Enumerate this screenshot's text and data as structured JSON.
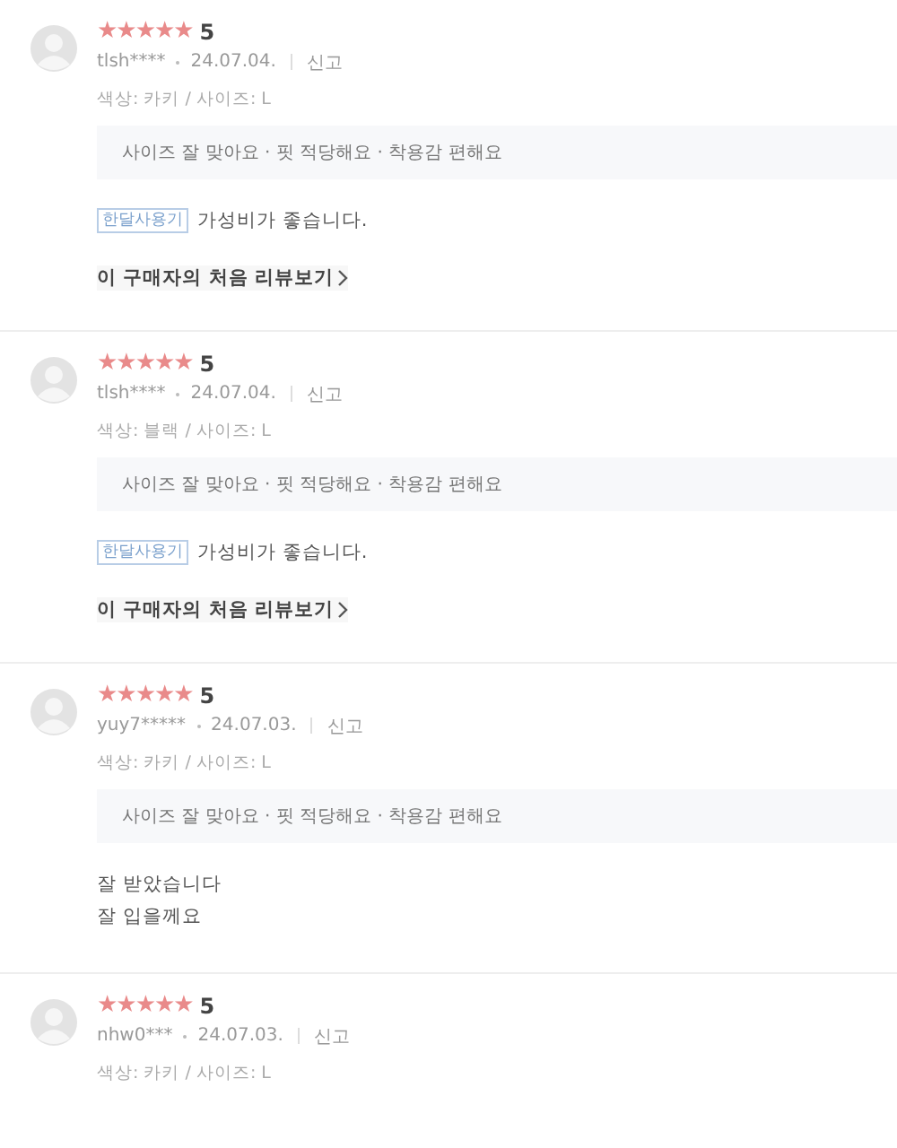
{
  "reviews": [
    {
      "stars": 5,
      "score": "5",
      "user": "tlsh****",
      "date": "24.07.04.",
      "report": "신고",
      "options": "색상: 카키 / 사이즈: L",
      "summary": "사이즈 잘 맞아요 · 핏 적당해요 · 착용감 편해요",
      "tag": "한달사용기",
      "body": [
        "가성비가 좋습니다."
      ],
      "first_review_link": "이 구매자의 처음 리뷰보기"
    },
    {
      "stars": 5,
      "score": "5",
      "user": "tlsh****",
      "date": "24.07.04.",
      "report": "신고",
      "options": "색상: 블랙 / 사이즈: L",
      "summary": "사이즈 잘 맞아요 · 핏 적당해요 · 착용감 편해요",
      "tag": "한달사용기",
      "body": [
        "가성비가 좋습니다."
      ],
      "first_review_link": "이 구매자의 처음 리뷰보기"
    },
    {
      "stars": 5,
      "score": "5",
      "user": "yuy7*****",
      "date": "24.07.03.",
      "report": "신고",
      "options": "색상: 카키 / 사이즈: L",
      "summary": "사이즈 잘 맞아요 · 핏 적당해요 · 착용감 편해요",
      "body": [
        "잘 받았습니다",
        "잘 입을께요"
      ]
    },
    {
      "stars": 5,
      "score": "5",
      "user": "nhw0***",
      "date": "24.07.03.",
      "report": "신고",
      "options": "색상: 카키 / 사이즈: L"
    }
  ]
}
